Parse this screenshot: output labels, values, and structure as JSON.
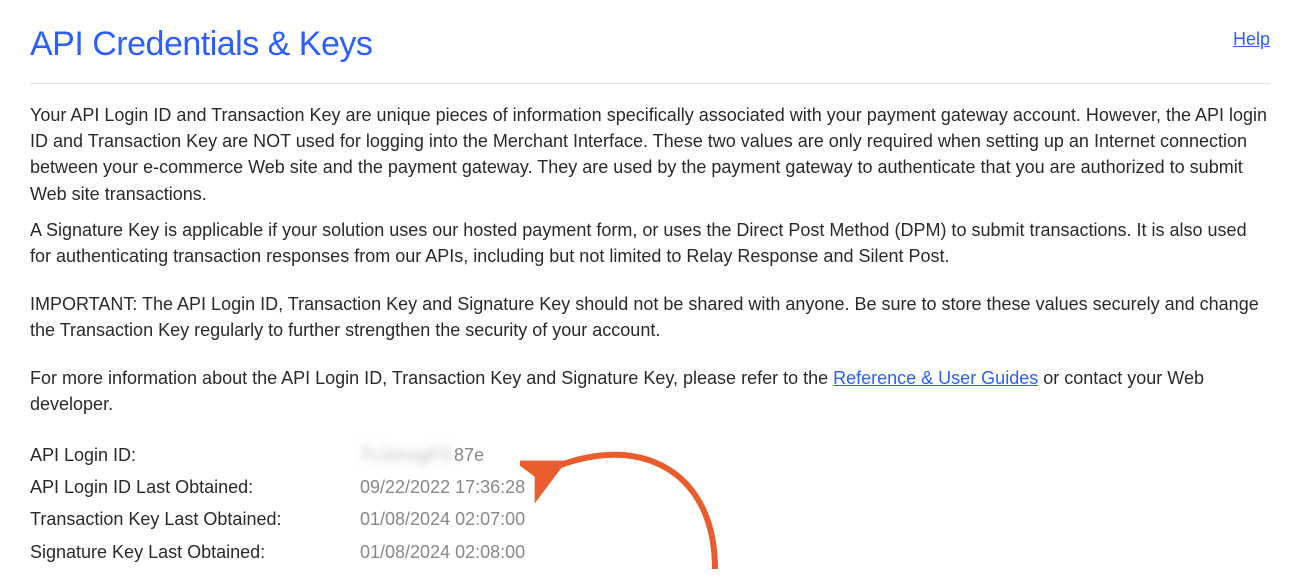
{
  "header": {
    "title": "API Credentials & Keys",
    "help_label": "Help"
  },
  "paragraphs": {
    "p1": "Your API Login ID and Transaction Key are unique pieces of information specifically associated with your payment gateway account. However, the API login ID and Transaction Key are NOT used for logging into the Merchant Interface. These two values are only required when setting up an Internet connection between your e-commerce Web site and the payment gateway. They are used by the payment gateway to authenticate that you are authorized to submit Web site transactions.",
    "p2": "A Signature Key is applicable if your solution uses our hosted payment form, or uses the Direct Post Method (DPM) to submit transactions. It is also used for authenticating transaction responses from our APIs, including but not limited to Relay Response and Silent Post.",
    "p3": "IMPORTANT: The API Login ID, Transaction Key and Signature Key should not be shared with anyone. Be sure to store these values securely and change the Transaction Key regularly to further strengthen the security of your account.",
    "p4_prefix": "For more information about the API Login ID, Transaction Key and Signature Key, please refer to the ",
    "p4_link": "Reference & User Guides",
    "p4_suffix": " or contact your Web developer."
  },
  "credentials": {
    "api_login_id": {
      "label": "API Login ID:",
      "value_masked": "7c3mvgF0",
      "value_visible": "87e"
    },
    "api_login_id_last_obtained": {
      "label": "API Login ID Last Obtained:",
      "value": "09/22/2022 17:36:28"
    },
    "transaction_key_last_obtained": {
      "label": "Transaction Key Last Obtained:",
      "value": "01/08/2024 02:07:00"
    },
    "signature_key_last_obtained": {
      "label": "Signature Key Last Obtained:",
      "value": "01/08/2024 02:08:00"
    }
  }
}
